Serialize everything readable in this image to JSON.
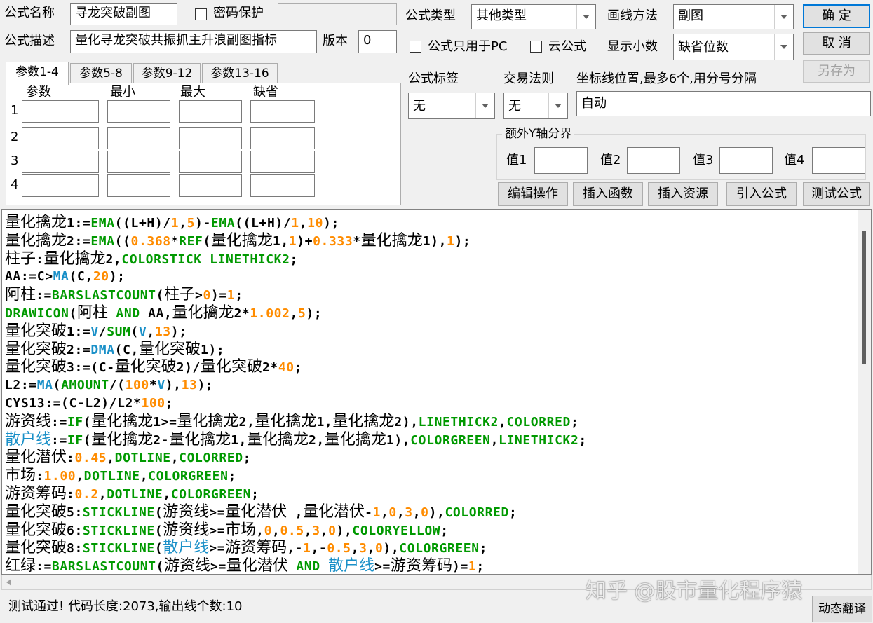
{
  "header": {
    "name_label": "公式名称",
    "name_value": "寻龙突破副图",
    "password_label": "密码保护",
    "password_checked": false,
    "password_value": "",
    "desc_label": "公式描述",
    "desc_value": "量化寻龙突破共振抓主升浪副图指标",
    "version_label": "版本",
    "version_value": "0",
    "type_label": "公式类型",
    "type_value": "其他类型",
    "draw_label": "画线方法",
    "draw_value": "副图",
    "pc_only_label": "公式只用于PC",
    "pc_only_checked": false,
    "cloud_label": "云公式",
    "cloud_checked": false,
    "decimals_label": "显示小数",
    "decimals_value": "缺省位数"
  },
  "buttons": {
    "ok": "确 定",
    "cancel": "取 消",
    "save_as": "另存为",
    "edit_ops": "编辑操作",
    "insert_func": "插入函数",
    "insert_res": "插入资源",
    "import_formula": "引入公式",
    "test_formula": "测试公式",
    "dynamic_translate": "动态翻译"
  },
  "params": {
    "tabs": [
      "参数1-4",
      "参数5-8",
      "参数9-12",
      "参数13-16"
    ],
    "active_tab": 0,
    "columns": [
      "参数",
      "最小",
      "最大",
      "缺省"
    ],
    "rows": [
      "1",
      "2",
      "3",
      "4"
    ]
  },
  "tags": {
    "tag_label": "公式标签",
    "tag_value": "无",
    "rule_label": "交易法则",
    "rule_value": "无",
    "axis_label": "坐标线位置,最多6个,用分号分隔",
    "axis_value": "自动"
  },
  "y_axis": {
    "group_title": "额外Y轴分界",
    "labels": [
      "值1",
      "值2",
      "值3",
      "值4"
    ],
    "values": [
      "",
      "",
      "",
      ""
    ]
  },
  "colors": {
    "keyword": "#009900",
    "function": "#1a90c8",
    "number": "#ff8c00",
    "text": "#000000"
  },
  "code_lines": [
    [
      [
        "t",
        "量化擒龙"
      ],
      [
        "t",
        "1:="
      ],
      [
        "k",
        "EMA"
      ],
      [
        "t",
        "(("
      ],
      [
        "t",
        "L"
      ],
      [
        "t",
        "+"
      ],
      [
        "t",
        "H"
      ],
      [
        "t",
        ")/"
      ],
      [
        "n",
        "1"
      ],
      [
        "t",
        ","
      ],
      [
        "n",
        "5"
      ],
      [
        "t",
        ")-"
      ],
      [
        "k",
        "EMA"
      ],
      [
        "t",
        "(("
      ],
      [
        "t",
        "L"
      ],
      [
        "t",
        "+"
      ],
      [
        "t",
        "H"
      ],
      [
        "t",
        ")/"
      ],
      [
        "n",
        "1"
      ],
      [
        "t",
        ","
      ],
      [
        "n",
        "10"
      ],
      [
        "t",
        ");"
      ]
    ],
    [
      [
        "t",
        "量化擒龙"
      ],
      [
        "t",
        "2:="
      ],
      [
        "k",
        "EMA"
      ],
      [
        "t",
        "(("
      ],
      [
        "n",
        "0.368"
      ],
      [
        "t",
        "*"
      ],
      [
        "k",
        "REF"
      ],
      [
        "t",
        "("
      ],
      [
        "t",
        "量化擒龙"
      ],
      [
        "t",
        "1,"
      ],
      [
        "n",
        "1"
      ],
      [
        "t",
        ")+"
      ],
      [
        "n",
        "0.333"
      ],
      [
        "t",
        "*"
      ],
      [
        "t",
        "量化擒龙"
      ],
      [
        "t",
        "1),"
      ],
      [
        "n",
        "1"
      ],
      [
        "t",
        ");"
      ]
    ],
    [
      [
        "t",
        "柱子:量化擒龙"
      ],
      [
        "t",
        "2,"
      ],
      [
        "k",
        "COLORSTICK LINETHICK2"
      ],
      [
        "t",
        ";"
      ]
    ],
    [
      [
        "t",
        "AA:="
      ],
      [
        "t",
        "C"
      ],
      [
        "t",
        ">"
      ],
      [
        "f",
        "MA"
      ],
      [
        "t",
        "("
      ],
      [
        "t",
        "C"
      ],
      [
        "t",
        ","
      ],
      [
        "n",
        "20"
      ],
      [
        "t",
        ");"
      ]
    ],
    [
      [
        "t",
        "阿柱"
      ],
      [
        "t",
        ":="
      ],
      [
        "k",
        "BARSLASTCOUNT"
      ],
      [
        "t",
        "("
      ],
      [
        "t",
        "柱子"
      ],
      [
        "t",
        ">"
      ],
      [
        "n",
        "0"
      ],
      [
        "t",
        ")="
      ],
      [
        "n",
        "1"
      ],
      [
        "t",
        ";"
      ]
    ],
    [
      [
        "k",
        "DRAWICON"
      ],
      [
        "t",
        "("
      ],
      [
        "t",
        "阿柱"
      ],
      [
        "t",
        " "
      ],
      [
        "k",
        "AND"
      ],
      [
        "t",
        " AA,"
      ],
      [
        "t",
        "量化擒龙"
      ],
      [
        "t",
        "2*"
      ],
      [
        "n",
        "1.002"
      ],
      [
        "t",
        ","
      ],
      [
        "n",
        "5"
      ],
      [
        "t",
        ");"
      ]
    ],
    [
      [
        "t",
        "量化突破"
      ],
      [
        "t",
        "1:="
      ],
      [
        "f",
        "V"
      ],
      [
        "t",
        "/"
      ],
      [
        "k",
        "SUM"
      ],
      [
        "t",
        "("
      ],
      [
        "f",
        "V"
      ],
      [
        "t",
        ","
      ],
      [
        "n",
        "13"
      ],
      [
        "t",
        ");"
      ]
    ],
    [
      [
        "t",
        "量化突破"
      ],
      [
        "t",
        "2:="
      ],
      [
        "f",
        "DMA"
      ],
      [
        "t",
        "("
      ],
      [
        "t",
        "C"
      ],
      [
        "t",
        ","
      ],
      [
        "t",
        "量化突破"
      ],
      [
        "t",
        "1);"
      ]
    ],
    [
      [
        "t",
        "量化突破"
      ],
      [
        "t",
        "3:=("
      ],
      [
        "t",
        "C"
      ],
      [
        "t",
        "-"
      ],
      [
        "t",
        "量化突破"
      ],
      [
        "t",
        "2)/"
      ],
      [
        "t",
        "量化突破"
      ],
      [
        "t",
        "2*"
      ],
      [
        "n",
        "40"
      ],
      [
        "t",
        ";"
      ]
    ],
    [
      [
        "t",
        "L2:="
      ],
      [
        "f",
        "MA"
      ],
      [
        "t",
        "("
      ],
      [
        "k",
        "AMOUNT"
      ],
      [
        "t",
        "/("
      ],
      [
        "n",
        "100"
      ],
      [
        "t",
        "*"
      ],
      [
        "f",
        "V"
      ],
      [
        "t",
        "),"
      ],
      [
        "n",
        "13"
      ],
      [
        "t",
        ");"
      ]
    ],
    [
      [
        "t",
        "CYS13:=("
      ],
      [
        "t",
        "C"
      ],
      [
        "t",
        "-L2)/L2*"
      ],
      [
        "n",
        "100"
      ],
      [
        "t",
        ";"
      ]
    ],
    [
      [
        "t",
        "游资线"
      ],
      [
        "t",
        ":="
      ],
      [
        "k",
        "IF"
      ],
      [
        "t",
        "("
      ],
      [
        "t",
        "量化擒龙"
      ],
      [
        "t",
        "1>="
      ],
      [
        "t",
        "量化擒龙"
      ],
      [
        "t",
        "2,"
      ],
      [
        "t",
        "量化擒龙"
      ],
      [
        "t",
        "1,"
      ],
      [
        "t",
        "量化擒龙"
      ],
      [
        "t",
        "2),"
      ],
      [
        "k",
        "LINETHICK2"
      ],
      [
        "t",
        ","
      ],
      [
        "k",
        "COLORRED"
      ],
      [
        "t",
        ";"
      ]
    ],
    [
      [
        "f",
        "散户线"
      ],
      [
        "t",
        ":="
      ],
      [
        "k",
        "IF"
      ],
      [
        "t",
        "("
      ],
      [
        "t",
        "量化擒龙"
      ],
      [
        "t",
        "2-"
      ],
      [
        "t",
        "量化擒龙"
      ],
      [
        "t",
        "1,"
      ],
      [
        "t",
        "量化擒龙"
      ],
      [
        "t",
        "2,"
      ],
      [
        "t",
        "量化擒龙"
      ],
      [
        "t",
        "1),"
      ],
      [
        "k",
        "COLORGREEN"
      ],
      [
        "t",
        ","
      ],
      [
        "k",
        "LINETHICK2"
      ],
      [
        "t",
        ";"
      ]
    ],
    [
      [
        "t",
        "量化潜伏"
      ],
      [
        "t",
        ":"
      ],
      [
        "n",
        "0.45"
      ],
      [
        "t",
        ","
      ],
      [
        "k",
        "DOTLINE"
      ],
      [
        "t",
        ","
      ],
      [
        "k",
        "COLORRED"
      ],
      [
        "t",
        ";"
      ]
    ],
    [
      [
        "t",
        "市场"
      ],
      [
        "t",
        ":"
      ],
      [
        "n",
        "1.00"
      ],
      [
        "t",
        ","
      ],
      [
        "k",
        "DOTLINE"
      ],
      [
        "t",
        ","
      ],
      [
        "k",
        "COLORGREEN"
      ],
      [
        "t",
        ";"
      ]
    ],
    [
      [
        "t",
        "游资筹码"
      ],
      [
        "t",
        ":"
      ],
      [
        "n",
        "0.2"
      ],
      [
        "t",
        ","
      ],
      [
        "k",
        "DOTLINE"
      ],
      [
        "t",
        ","
      ],
      [
        "k",
        "COLORGREEN"
      ],
      [
        "t",
        ";"
      ]
    ],
    [
      [
        "t",
        "量化突破"
      ],
      [
        "t",
        "5:"
      ],
      [
        "k",
        "STICKLINE"
      ],
      [
        "t",
        "("
      ],
      [
        "t",
        "游资线"
      ],
      [
        "t",
        ">="
      ],
      [
        "t",
        "量化潜伏"
      ],
      [
        "t",
        " ,"
      ],
      [
        "t",
        "量化潜伏"
      ],
      [
        "t",
        "-"
      ],
      [
        "n",
        "1"
      ],
      [
        "t",
        ","
      ],
      [
        "n",
        "0"
      ],
      [
        "t",
        ","
      ],
      [
        "n",
        "3"
      ],
      [
        "t",
        ","
      ],
      [
        "n",
        "0"
      ],
      [
        "t",
        "),"
      ],
      [
        "k",
        "COLORRED"
      ],
      [
        "t",
        ";"
      ]
    ],
    [
      [
        "t",
        "量化突破"
      ],
      [
        "t",
        "6:"
      ],
      [
        "k",
        "STICKLINE"
      ],
      [
        "t",
        "("
      ],
      [
        "t",
        "游资线"
      ],
      [
        "t",
        ">="
      ],
      [
        "t",
        "市场"
      ],
      [
        "t",
        ","
      ],
      [
        "n",
        "0"
      ],
      [
        "t",
        ","
      ],
      [
        "n",
        "0.5"
      ],
      [
        "t",
        ","
      ],
      [
        "n",
        "3"
      ],
      [
        "t",
        ","
      ],
      [
        "n",
        "0"
      ],
      [
        "t",
        "),"
      ],
      [
        "k",
        "COLORYELLOW"
      ],
      [
        "t",
        ";"
      ]
    ],
    [
      [
        "t",
        "量化突破"
      ],
      [
        "t",
        "8:"
      ],
      [
        "k",
        "STICKLINE"
      ],
      [
        "t",
        "("
      ],
      [
        "f",
        "散户线"
      ],
      [
        "t",
        ">="
      ],
      [
        "t",
        "游资筹码"
      ],
      [
        "t",
        ",-"
      ],
      [
        "n",
        "1"
      ],
      [
        "t",
        ",-"
      ],
      [
        "n",
        "0.5"
      ],
      [
        "t",
        ","
      ],
      [
        "n",
        "3"
      ],
      [
        "t",
        ","
      ],
      [
        "n",
        "0"
      ],
      [
        "t",
        "),"
      ],
      [
        "k",
        "COLORGREEN"
      ],
      [
        "t",
        ";"
      ]
    ],
    [
      [
        "t",
        "红绿"
      ],
      [
        "t",
        ":="
      ],
      [
        "k",
        "BARSLASTCOUNT"
      ],
      [
        "t",
        "("
      ],
      [
        "t",
        "游资线"
      ],
      [
        "t",
        ">="
      ],
      [
        "t",
        "量化潜伏"
      ],
      [
        "t",
        " "
      ],
      [
        "k",
        "AND"
      ],
      [
        "t",
        " "
      ],
      [
        "f",
        "散户线"
      ],
      [
        "t",
        ">="
      ],
      [
        "t",
        "游资筹码"
      ],
      [
        "t",
        ")="
      ],
      [
        "n",
        "1"
      ],
      [
        "t",
        ";"
      ]
    ]
  ],
  "status": "测试通过! 代码长度:2073,输出线个数:10",
  "watermark": "知乎 @股市量化程序猿"
}
